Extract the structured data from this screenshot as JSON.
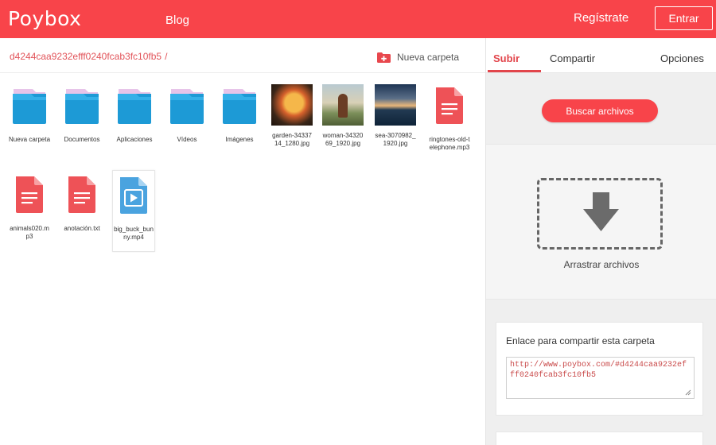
{
  "header": {
    "logo": "Poybox",
    "blog": "Blog",
    "register": "Regístrate",
    "login": "Entrar",
    "accent_color": "#f8444a"
  },
  "toolbar": {
    "path": "d4244caa9232efff0240fcab3fc10fb5",
    "path_separator": "/",
    "new_folder": "Nueva carpeta",
    "new_folder_icon": "folder-plus-icon"
  },
  "files": [
    {
      "name": "Nueva carpeta",
      "kind": "folder",
      "icon": "folder-icon"
    },
    {
      "name": "Documentos",
      "kind": "folder",
      "icon": "folder-icon"
    },
    {
      "name": "Aplicaciones",
      "kind": "folder",
      "icon": "folder-icon"
    },
    {
      "name": "Vídeos",
      "kind": "folder",
      "icon": "folder-icon"
    },
    {
      "name": "Imágenes",
      "kind": "folder",
      "icon": "folder-icon"
    },
    {
      "name": "garden-3433714_1280.jpg",
      "kind": "image",
      "icon": "image-thumbnail"
    },
    {
      "name": "woman-3432069_1920.jpg",
      "kind": "image",
      "icon": "image-thumbnail"
    },
    {
      "name": "sea-3070982_1920.jpg",
      "kind": "image",
      "icon": "image-thumbnail"
    },
    {
      "name": "ringtones-old-telephone.mp3",
      "kind": "document",
      "icon": "document-icon"
    },
    {
      "name": "animals020.mp3",
      "kind": "document",
      "icon": "document-icon"
    },
    {
      "name": "anotación.txt",
      "kind": "document",
      "icon": "document-icon"
    },
    {
      "name": "big_buck_bunny.mp4",
      "kind": "video",
      "icon": "video-file-icon",
      "selected": true
    }
  ],
  "panel": {
    "tabs": {
      "upload": "Subir",
      "share": "Compartir",
      "options": "Opciones"
    },
    "search_button": "Buscar archivos",
    "drop_label": "Arrastrar archivos",
    "drop_icon": "download-arrow-icon",
    "share_title": "Enlace para compartir esta carpeta",
    "share_link": "http://www.poybox.com/#d4244caa9232efff0240fcab3fc10fb5"
  }
}
